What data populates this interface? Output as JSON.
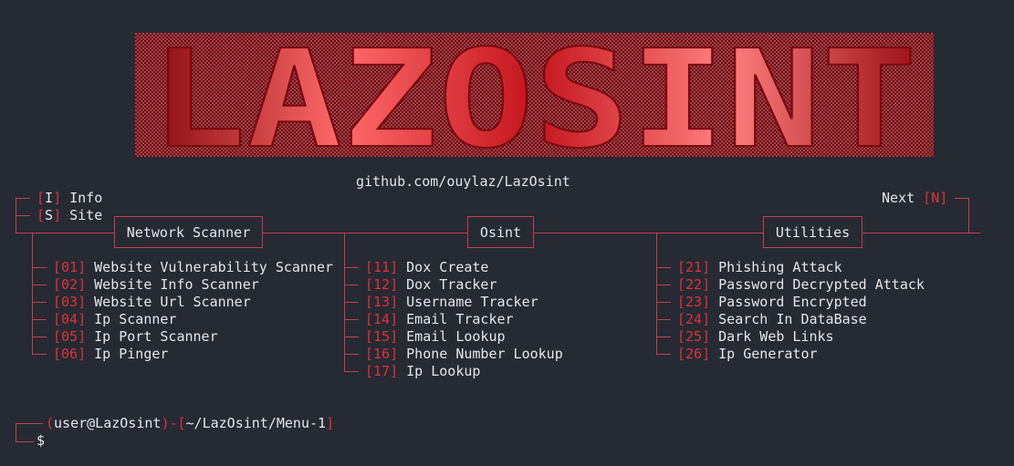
{
  "banner": {
    "text": "LAZOSINT"
  },
  "repo_url": "github.com/ouylaz/LazOsint",
  "top_left": [
    {
      "key": "I",
      "label": "Info"
    },
    {
      "key": "S",
      "label": "Site"
    }
  ],
  "next": {
    "label": "Next",
    "key": "N"
  },
  "sections": [
    {
      "title": "Network Scanner",
      "items": [
        {
          "num": "01",
          "label": "Website Vulnerability Scanner"
        },
        {
          "num": "02",
          "label": "Website Info Scanner"
        },
        {
          "num": "03",
          "label": "Website Url Scanner"
        },
        {
          "num": "04",
          "label": "Ip Scanner"
        },
        {
          "num": "05",
          "label": "Ip Port Scanner"
        },
        {
          "num": "06",
          "label": "Ip Pinger"
        }
      ]
    },
    {
      "title": "Osint",
      "items": [
        {
          "num": "11",
          "label": "Dox Create"
        },
        {
          "num": "12",
          "label": "Dox Tracker"
        },
        {
          "num": "13",
          "label": "Username Tracker"
        },
        {
          "num": "14",
          "label": "Email Tracker"
        },
        {
          "num": "15",
          "label": "Email Lookup"
        },
        {
          "num": "16",
          "label": "Phone Number Lookup"
        },
        {
          "num": "17",
          "label": "Ip Lookup"
        }
      ]
    },
    {
      "title": "Utilities",
      "items": [
        {
          "num": "21",
          "label": "Phishing Attack"
        },
        {
          "num": "22",
          "label": "Password Decrypted Attack"
        },
        {
          "num": "23",
          "label": "Password Encrypted"
        },
        {
          "num": "24",
          "label": "Search In DataBase"
        },
        {
          "num": "25",
          "label": "Dark Web Links"
        },
        {
          "num": "26",
          "label": "Ip Generator"
        }
      ]
    }
  ],
  "prompt": {
    "user": "user@LazOsint",
    "path": "~/LazOsint/Menu-1",
    "symbol": "$"
  },
  "colors": {
    "accent": "#e0303a",
    "background": "#262a33",
    "text": "#e6e6e6"
  }
}
